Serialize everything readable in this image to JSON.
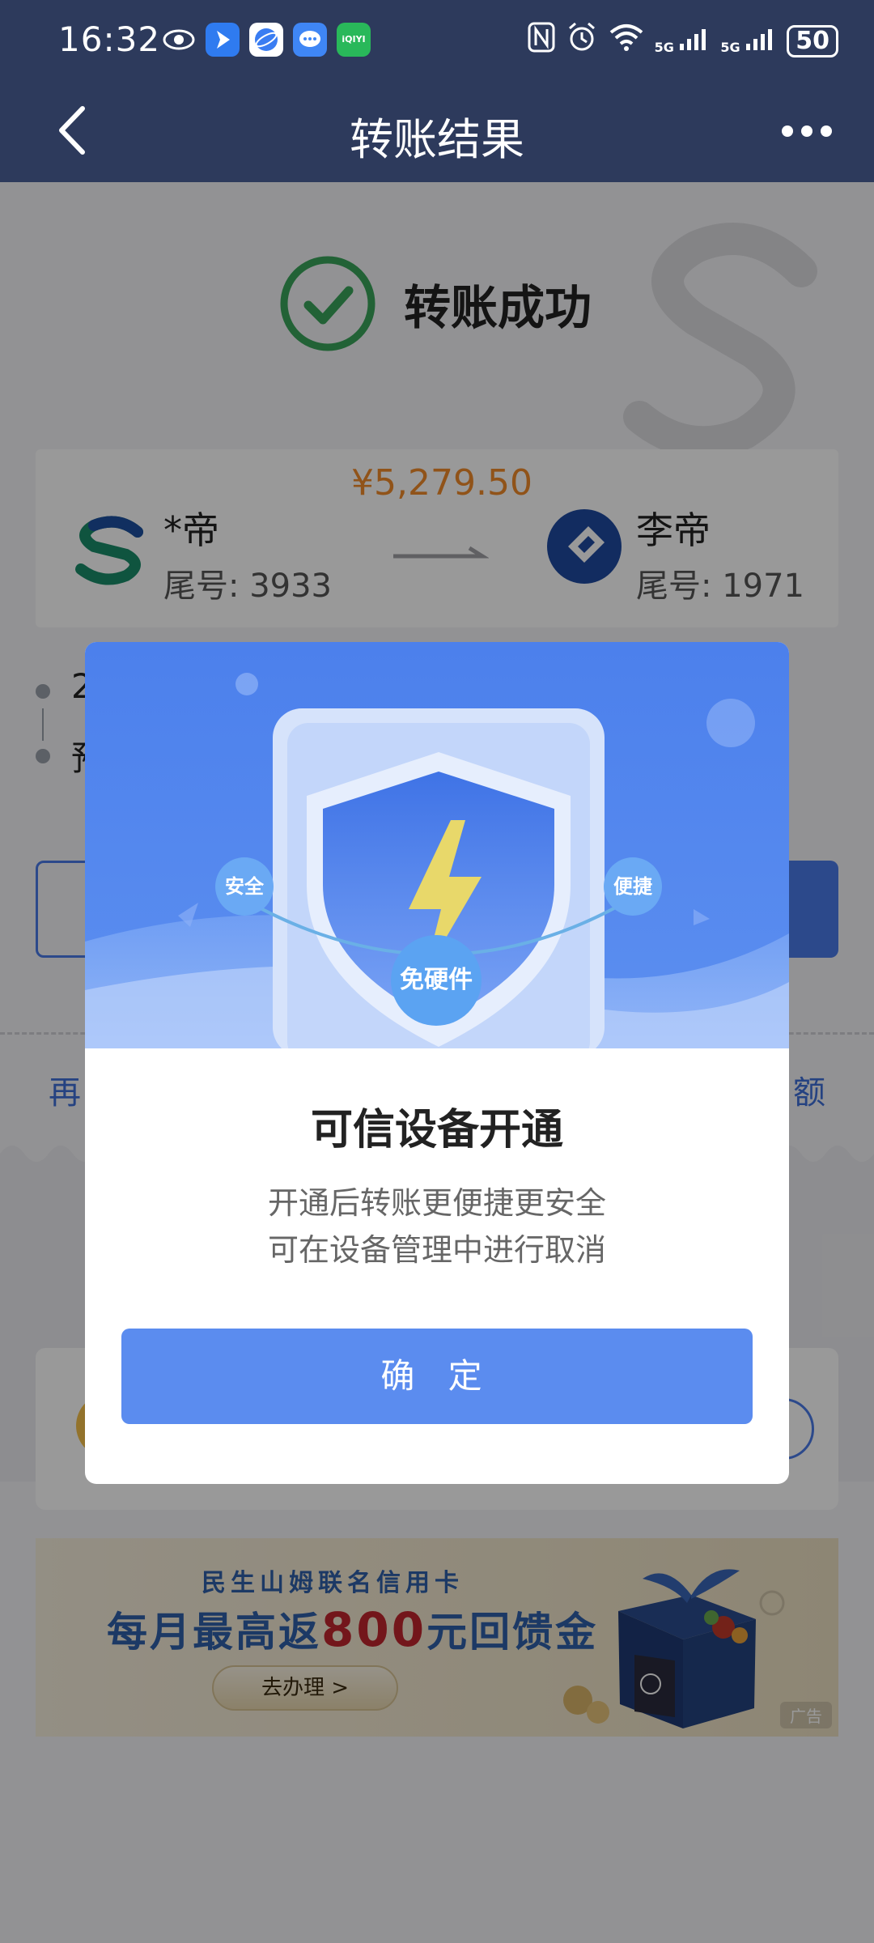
{
  "status_bar": {
    "time": "16:32",
    "left_icons": [
      "eye-icon",
      "navigation-app-icon",
      "browser-app-icon",
      "message-app-icon",
      "iqiyi-app-icon"
    ],
    "iqiyi_label": "iQIYI",
    "signal_1": "5G",
    "signal_2": "5G",
    "wifi_label": "6",
    "battery": "50"
  },
  "header": {
    "title": "转账结果"
  },
  "result": {
    "status_text": "转账成功",
    "amount": "¥5,279.50",
    "from_name": "*帝",
    "from_tail": "尾号: 3933",
    "to_name": "李帝",
    "to_tail": "尾号: 1971",
    "timeline_1_prefix": "2",
    "timeline_2_prefix": "预"
  },
  "links": {
    "left_partial": "再",
    "right_partial": "额"
  },
  "ad": {
    "subtitle": "民生山姆联名信用卡",
    "headline_pre": "每月最高返",
    "headline_amount": "800",
    "headline_post": "元回馈金",
    "button": "去办理 >",
    "tag": "广告"
  },
  "modal": {
    "badge_left": "安全",
    "badge_right": "便捷",
    "badge_center": "免硬件",
    "title": "可信设备开通",
    "desc_line1": "开通后转账更便捷更安全",
    "desc_line2": "可在设备管理中进行取消",
    "confirm": "确 定"
  },
  "colors": {
    "header_bg": "#2d3a5c",
    "success_green": "#3aa35a",
    "amount_orange": "#f08a2a",
    "primary_blue": "#5b8cef",
    "ad_blue": "#2f5fa8",
    "ad_red": "#c0262d"
  }
}
